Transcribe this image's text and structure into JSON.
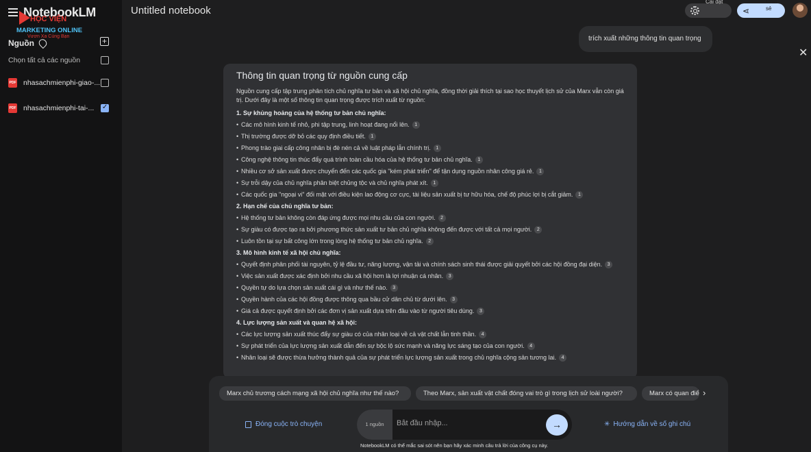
{
  "sidebar": {
    "brand": "NotebookLM",
    "logo": {
      "line1": "HỌC VIỆN",
      "line2": "MARKETING ONLINE",
      "line3": "Vươn Xa Cùng Bạn"
    },
    "sources_title": "Nguồn",
    "select_all": "Chọn tất cả các nguồn",
    "sources": [
      {
        "name": "nhasachmienphi-giao-...",
        "checked": false
      },
      {
        "name": "nhasachmienphi-tai-...",
        "checked": true
      }
    ],
    "pdf_label": "PDF"
  },
  "header": {
    "title": "Untitled notebook",
    "settings_label": "Cài đặt",
    "share_label": "Chia sẻ"
  },
  "chat": {
    "user_message": "trích xuất những thông tin quan trọng",
    "answer": {
      "title": "Thông tin quan trọng từ nguồn cung cấp",
      "intro": "Nguồn cung cấp tập trung phân tích chủ nghĩa tư bản và xã hội chủ nghĩa, đồng thời giải thích tại sao học thuyết lịch sử của Marx vẫn còn giá trị. Dưới đây là một số thông tin quan trọng được trích xuất từ nguồn:",
      "sections": [
        {
          "title": "1. Sự khủng hoảng của hệ thống tư bản chủ nghĩa:",
          "items": [
            {
              "text": "Các mô hình kinh tế nhỏ, phi tập trung, linh hoạt đang nổi lên.",
              "cite": "1"
            },
            {
              "text": "Thị trường được dỡ bỏ các quy định điều tiết.",
              "cite": "1"
            },
            {
              "text": "Phong trào giai cấp công nhân bị đè nén cả về luật pháp lẫn chính trị.",
              "cite": "1"
            },
            {
              "text": "Công nghệ thông tin thúc đẩy quá trình toàn cầu hóa của hệ thống tư bản chủ nghĩa.",
              "cite": "1"
            },
            {
              "text": "Nhiều cơ sở sản xuất được chuyển đến các quốc gia \"kém phát triển\" để tận dụng nguồn nhân công giá rẻ.",
              "cite": "1"
            },
            {
              "text": "Sự trỗi dậy của chủ nghĩa phân biệt chủng tộc và chủ nghĩa phát xít.",
              "cite": "1"
            },
            {
              "text": "Các quốc gia \"ngoại vi\" đối mặt với điều kiện lao động cơ cực, tài liệu sản xuất bị tư hữu hóa, chế độ phúc lợi bị cắt giảm.",
              "cite": "1"
            }
          ]
        },
        {
          "title": "2. Hạn chế của chủ nghĩa tư bản:",
          "items": [
            {
              "text": "Hệ thống tư bản không còn đáp ứng được mọi nhu cầu của con người.",
              "cite": "2"
            },
            {
              "text": "Sự giàu có được tạo ra bởi phương thức sản xuất tư bản chủ nghĩa không đến được với tất cả mọi người.",
              "cite": "2"
            },
            {
              "text": "Luôn tồn tại sự bất công lớn trong lòng hệ thống tư bản chủ nghĩa.",
              "cite": "2"
            }
          ]
        },
        {
          "title": "3. Mô hình kinh tế xã hội chủ nghĩa:",
          "items": [
            {
              "text": "Quyết định phân phối tài nguyên, tỷ lệ đầu tư, năng lượng, vận tải và chính sách sinh thái được giải quyết bởi các hội đồng đại diện.",
              "cite": "3"
            },
            {
              "text": "Việc sản xuất được xác định bởi nhu cầu xã hội hơn là lợi nhuận cá nhân.",
              "cite": "3"
            },
            {
              "text": "Quyền tự do lựa chọn sản xuất cái gì và như thế nào.",
              "cite": "3"
            },
            {
              "text": "Quyền hành của các hội đồng được thông qua bầu cử dân chủ từ dưới lên.",
              "cite": "3"
            },
            {
              "text": "Giá cả được quyết định bởi các đơn vị sản xuất dựa trên đầu vào từ người tiêu dùng.",
              "cite": "3"
            }
          ]
        },
        {
          "title": "4. Lực lượng sản xuất và quan hệ xã hội:",
          "items": [
            {
              "text": "Các lực lượng sản xuất thúc đẩy sự giàu có của nhân loại về cả vật chất lẫn tinh thần.",
              "cite": "4"
            },
            {
              "text": "Sự phát triển của lực lượng sản xuất dẫn đến sự bộc lộ sức mạnh và năng lực sáng tạo của con người.",
              "cite": "4"
            },
            {
              "text": "Nhân loại sẽ được thừa hưởng thành quả của sự phát triển lực lượng sản xuất trong chủ nghĩa cộng sản tương lai.",
              "cite": "4"
            }
          ]
        }
      ]
    }
  },
  "suggestions": [
    "Marx chủ trương cách mạng xã hội chủ nghĩa như thế nào?",
    "Theo Marx, sản xuất vật chất đóng vai trò gì trong lịch sử loài người?",
    "Marx có quan điểm gì"
  ],
  "footer": {
    "save_chat": "Đóng cuộc trò chuyện",
    "source_count": "1 nguồn",
    "input_placeholder": "Bắt đầu nhập...",
    "notes_guide": "Hướng dẫn về số ghi chú",
    "disclaimer": "NotebookLM có thể mắc sai sót nên bạn hãy xác minh câu trả lời của công cụ này."
  }
}
